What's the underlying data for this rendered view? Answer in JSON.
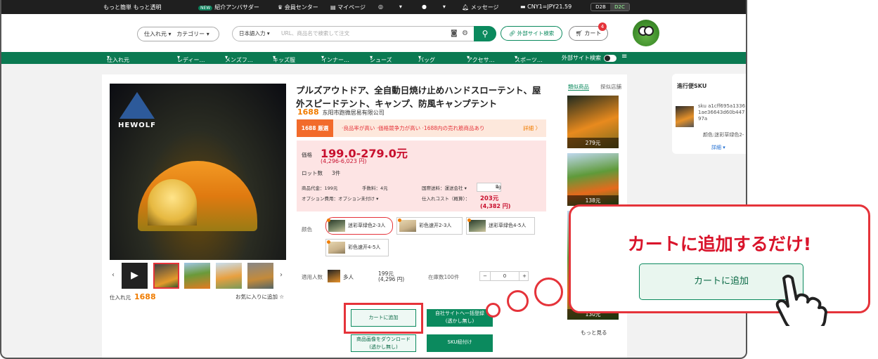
{
  "topbar": {
    "brand": "もっと簡単 もっと透明",
    "new_badge": "NEW",
    "referral": "紹介アンバサダー",
    "membership": "会員センター",
    "mypage": "マイページ",
    "messages": "メッセージ",
    "rate": "CNY1=JPY21.59",
    "mode_left": "D2B",
    "mode_right": "D2C"
  },
  "header": {
    "supplier_select": "仕入れ元",
    "category_select": "カテゴリー",
    "search_lang": "日本語入力",
    "search_placeholder": "URL、商品名で検索して注文",
    "outside_button": "外部サイト検索",
    "cart_label": "カート",
    "cart_count": "4"
  },
  "nav": {
    "items": [
      "仕入れ元",
      "レディー…",
      "メンズフ…",
      "キッズ服",
      "インナー…",
      "シューズ",
      "バッグ",
      "アクセサ…",
      "スポーツ…",
      "外部サイト検索"
    ]
  },
  "product": {
    "title": "プルズアウトドア、全自動日焼け止めハンドスローテント、屋外スピードテント、キャンプ、防風キャンプテント",
    "brand_logo": "1688",
    "shop": "东阳市跑微居易有限公司",
    "promo_tag": "1688 厳選",
    "promo_text": "·良品率が高い ·価格競争力が高い ·1688内の売れ筋商品あり",
    "promo_more": "詳細 〉",
    "price_label": "価格",
    "price": "199.0-279.0元",
    "price_yen": "(4,296-6,023 円)",
    "moq_label": "ロット数",
    "moq": "3件",
    "goods_fee": "商品代金：199元",
    "handling_fee": "手数料：4元",
    "domestic_ship": "国際送料：運送会社",
    "weight": "1",
    "weight_unit": "kg",
    "option_fee": "オプション費用：オプション未付け",
    "cost_label": "仕入れコスト（概算）：",
    "cost": "203元",
    "cost_yen": "(4,382 円)",
    "color_label": "颜色",
    "options": [
      "迷彩草绿色2-3人",
      "彩色速开2-3人",
      "迷彩草绿色4-5人",
      "彩色速开4-5人"
    ],
    "people_label": "適用人数",
    "people_value": "多人",
    "unit_price": "199元",
    "unit_price_yen": "(4,296 円)",
    "stock": "在庫数100件",
    "qty": "0",
    "add_cart": "カートに追加",
    "download": "商品画像をダウンロード\n(透かし無し)",
    "own_site": "自社サイトへ一括登録\n(透かし無し)",
    "sku_link": "SKU紐付け",
    "seller_label": "仕入れ元",
    "seller_logo": "1688",
    "favorite": "お気に入りに追加 ☆",
    "main_logo": "HEWOLF"
  },
  "related": {
    "tab_similar": "類似商品",
    "tab_store": "探似店舗",
    "prices": [
      "279元",
      "138元",
      "130元"
    ],
    "more": "もっと見る"
  },
  "sku_panel": {
    "title": "進行便SKU",
    "sku_text": "sku a1cff695a1336 1ae36643d60b447 97a",
    "option": "颜色:迷彩草绿色2-",
    "detail": "詳細 ▾"
  },
  "callout": {
    "message": "カートに追加するだけ!",
    "button": "カートに追加"
  }
}
